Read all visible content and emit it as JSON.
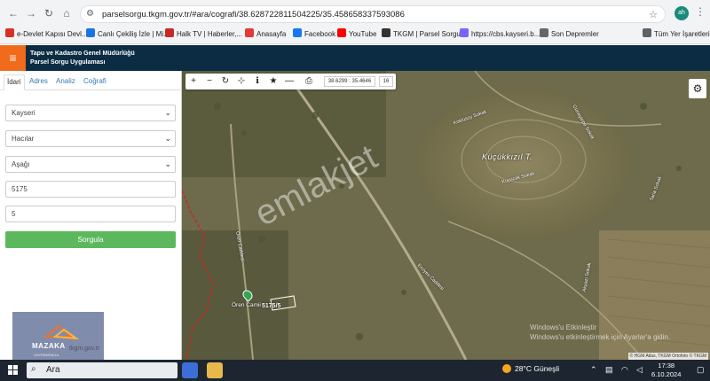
{
  "browser": {
    "url": "parselsorgu.tkgm.gov.tr/#ara/cografi/38.628722811504225/35.458658337593086",
    "profile_initials": "ah",
    "bookmarks": [
      {
        "label": "e-Devlet Kapısı Devl...",
        "color": "#d93025"
      },
      {
        "label": "Canlı Çekiliş İzle | Mi...",
        "color": "#1a73e8"
      },
      {
        "label": "Halk TV | Haberler,...",
        "color": "#c62828"
      },
      {
        "label": "Anasayfa",
        "color": "#e53935"
      },
      {
        "label": "Facebook",
        "color": "#1877f2"
      },
      {
        "label": "YouTube",
        "color": "#ff0000"
      },
      {
        "label": "TKGM | Parsel Sorgu...",
        "color": "#333333"
      },
      {
        "label": "https://cbs.kayseri.b...",
        "color": "#7b61ff"
      },
      {
        "label": "Son Depremler",
        "color": "#666666"
      },
      {
        "label": "Tüm Yer İşaretleri",
        "color": "#5f6368"
      }
    ]
  },
  "app": {
    "title_line1": "Tapu ve Kadastro Genel Müdürlüğü",
    "title_line2": "Parsel Sorgu Uygulaması",
    "accent": "#f26a1b",
    "header_bg": "#0c2c44"
  },
  "panel": {
    "tabs": [
      "İdari",
      "Adres",
      "Analiz",
      "Coğrafi"
    ],
    "active_tab": "İdari",
    "il": "Kayseri",
    "ilce": "Hacılar",
    "mahalle": "Aşağı",
    "ada": "5175",
    "parsel": "5",
    "query_button": "Sorgula",
    "query_button_color": "#5cb85c",
    "contact_email": "tkgm.gov.tr",
    "logo_text": "MAZAKA",
    "logo_sub": "GAYRİMENKUL"
  },
  "map": {
    "coordinates": "38.6299 : 35.4646",
    "zoom": "16",
    "place_name": "Küçükkızıl T.",
    "watermark": "emlakjet",
    "marker_label": "Ören Camii",
    "parcel_label": "5175/5",
    "attribution": "© HGM Atlas, TKGM Ortofoto © TKGM",
    "street_labels": [
      "Köklüsoy Sokak",
      "Kuyucak Sokak",
      "Erciyes Caddesi",
      "Ören Caddesi",
      "Akyazı Sokak",
      "Güneştepe Sokak",
      "Tarla Sokak"
    ],
    "windows_notice_1": "Windows'u Etkinleştir",
    "windows_notice_2": "Windows'u etkinleştirmek için Ayarlar'a gidin."
  },
  "taskbar": {
    "search_placeholder": "Ara",
    "weather": "28°C  Güneşli",
    "time": "17:38",
    "date": "6.10.2024"
  }
}
